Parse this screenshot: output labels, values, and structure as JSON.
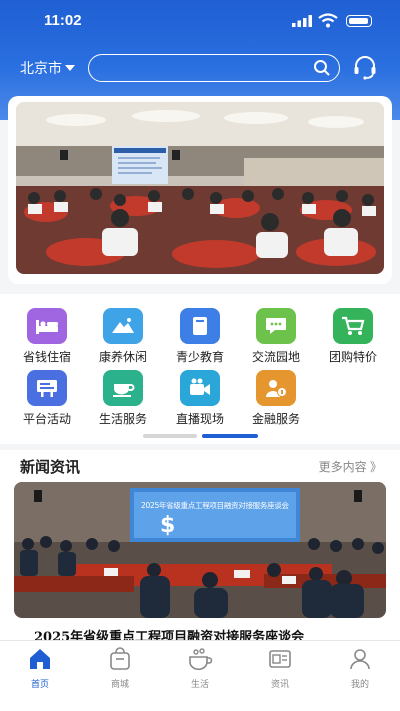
{
  "status_bar": {
    "time": "11:02"
  },
  "header": {
    "city": "北京市",
    "search": {
      "placeholder": ""
    }
  },
  "categories": [
    {
      "label": "省钱住宿",
      "icon": "bed-icon",
      "color": "#a065e0"
    },
    {
      "label": "康养休闲",
      "icon": "mountain-icon",
      "color": "#3fa3e8"
    },
    {
      "label": "青少教育",
      "icon": "book-icon",
      "color": "#3d7fe6"
    },
    {
      "label": "交流园地",
      "icon": "chat-icon",
      "color": "#6cc24a"
    },
    {
      "label": "团购特价",
      "icon": "cart-icon",
      "color": "#35b35a"
    },
    {
      "label": "平台活动",
      "icon": "billboard-icon",
      "color": "#4a6fe0"
    },
    {
      "label": "生活服务",
      "icon": "cup-icon",
      "color": "#2bb28c"
    },
    {
      "label": "直播现场",
      "icon": "video-icon",
      "color": "#2aa7d8"
    },
    {
      "label": "金融服务",
      "icon": "finance-icon",
      "color": "#e6962e"
    }
  ],
  "news": {
    "section_title": "新闻资讯",
    "more_label": "更多内容 》",
    "headline": "2025年省级重点工程项目融资对接服务座谈会",
    "banner_text": "2025年省级重点工程项目融资对接服务座谈会"
  },
  "tabbar": [
    {
      "label": "首页",
      "icon": "home-icon",
      "active": true
    },
    {
      "label": "商城",
      "icon": "shopping-bag-icon",
      "active": false
    },
    {
      "label": "生活",
      "icon": "coffee-icon",
      "active": false
    },
    {
      "label": "资讯",
      "icon": "news-icon",
      "active": false
    },
    {
      "label": "我的",
      "icon": "user-icon",
      "active": false
    }
  ]
}
